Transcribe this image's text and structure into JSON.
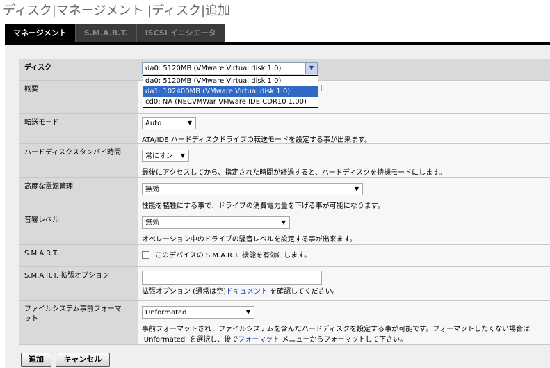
{
  "page": {
    "title": "ディスク|マネージメント |ディスク|追加"
  },
  "tabs": [
    {
      "label": "マネージメント",
      "active": true
    },
    {
      "label": "S.M.A.R.T.",
      "active": false
    },
    {
      "label": "iSCSI イニシエータ",
      "active": false
    }
  ],
  "form": {
    "disk": {
      "label": "ディスク",
      "value": "da0: 5120MB (VMware Virtual disk 1.0)",
      "options": [
        "da0: 5120MB (VMware Virtual disk 1.0)",
        "da1: 102400MB (VMware Virtual disk 1.0)",
        "cd0: NA (NECVMWar VMware IDE CDR10 1.00)"
      ],
      "highlighted_index": 1
    },
    "summary": {
      "label": "概要"
    },
    "transfer": {
      "label": "転送モード",
      "value": "Auto",
      "desc": "ATA/IDE ハードディスクドライブの転送モードを設定する事が出来ます。"
    },
    "standby": {
      "label": "ハードディスクスタンバイ時間",
      "value": "常にオン",
      "desc": "最後にアクセスしてから、指定された時間が経過すると、ハードディスクを待機モードにします。"
    },
    "apm": {
      "label": "高度な電源管理",
      "value": "無効",
      "desc": "性能を犠牲にする事で、ドライブの消費電力量を下げる事が可能になります。"
    },
    "acoustic": {
      "label": "音響レベル",
      "value": "無効",
      "desc": "オペレーション中のドライブの騒音レベルを設定する事が出来ます。"
    },
    "smart": {
      "label": "S.M.A.R.T.",
      "checkbox_label": "このデバイスの S.M.A.R.T. 機能を有効にします。",
      "checked": false
    },
    "smart_ext": {
      "label": "S.M.A.R.T. 拡張オプション",
      "value": "",
      "desc_pre": "拡張オプション (通常は空)",
      "desc_link": "ドキュメント",
      "desc_post": " を確認してください。"
    },
    "preformat": {
      "label": "ファイルシステム事前フォーマット",
      "value": "Unformated",
      "desc_line1": "事前フォーマットされ、ファイルシステムを含んだハードディスクを設定する事が可能です。フォーマットしたくない場合は",
      "desc_line2_pre": "'Unformated' を選択し、後で",
      "desc_link": "フォーマット",
      "desc_line2_post": " メニューからフォーマットして下さい。"
    }
  },
  "buttons": {
    "add": "追加",
    "cancel": "キャンセル"
  }
}
